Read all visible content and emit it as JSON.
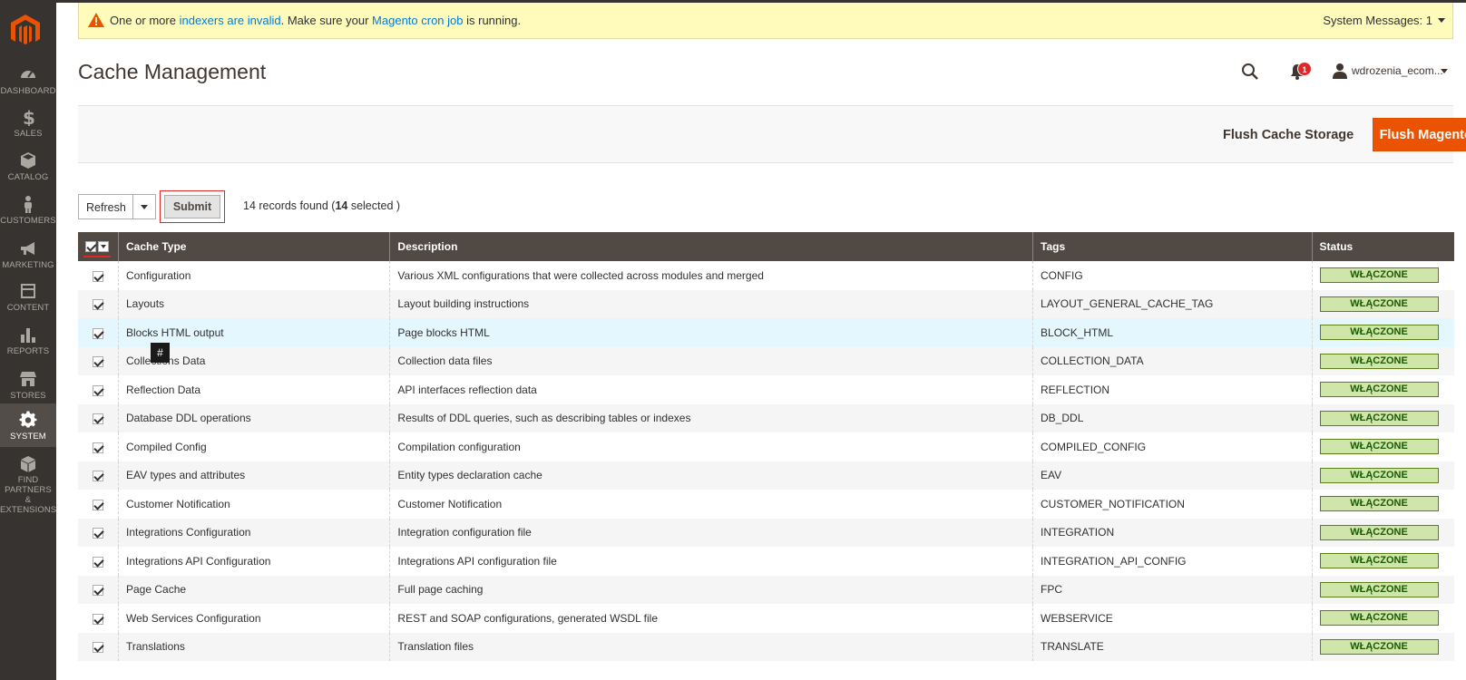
{
  "sidebar": {
    "items": [
      {
        "label": "DASHBOARD",
        "icon": "dashboard-icon"
      },
      {
        "label": "SALES",
        "icon": "dollar-icon"
      },
      {
        "label": "CATALOG",
        "icon": "box-icon"
      },
      {
        "label": "CUSTOMERS",
        "icon": "person-icon"
      },
      {
        "label": "MARKETING",
        "icon": "megaphone-icon"
      },
      {
        "label": "CONTENT",
        "icon": "layout-icon"
      },
      {
        "label": "REPORTS",
        "icon": "bar-chart-icon"
      },
      {
        "label": "STORES",
        "icon": "store-icon"
      },
      {
        "label": "SYSTEM",
        "icon": "gear-icon"
      },
      {
        "label": "FIND PARTNERS",
        "label2": "& EXTENSIONS",
        "icon": "cube-icon"
      }
    ],
    "active": "SYSTEM"
  },
  "system_message": {
    "part1": "One or more ",
    "link1": "indexers are invalid",
    "part2": ". Make sure your ",
    "link2": "Magento cron job",
    "part3": " is running.",
    "count_label": "System Messages: 1"
  },
  "header": {
    "title": "Cache Management",
    "notifications_count": "1",
    "user_name": "wdrozenia_ecom..."
  },
  "actions": {
    "flush_storage": "Flush Cache Storage",
    "flush_magento": "Flush Magento Cache"
  },
  "massaction": {
    "selected_option": "Refresh",
    "submit_label": "Submit",
    "records_prefix": "14 records found (",
    "records_selected": "14",
    "records_suffix": " selected )"
  },
  "grid": {
    "columns": [
      "Cache Type",
      "Description",
      "Tags",
      "Status"
    ],
    "rows": [
      {
        "type": "Configuration",
        "description": "Various XML configurations that were collected across modules and merged",
        "tags": "CONFIG",
        "status": "WŁĄCZONE"
      },
      {
        "type": "Layouts",
        "description": "Layout building instructions",
        "tags": "LAYOUT_GENERAL_CACHE_TAG",
        "status": "WŁĄCZONE"
      },
      {
        "type": "Blocks HTML output",
        "description": "Page blocks HTML",
        "tags": "BLOCK_HTML",
        "status": "WŁĄCZONE"
      },
      {
        "type": "Collections Data",
        "description": "Collection data files",
        "tags": "COLLECTION_DATA",
        "status": "WŁĄCZONE"
      },
      {
        "type": "Reflection Data",
        "description": "API interfaces reflection data",
        "tags": "REFLECTION",
        "status": "WŁĄCZONE"
      },
      {
        "type": "Database DDL operations",
        "description": "Results of DDL queries, such as describing tables or indexes",
        "tags": "DB_DDL",
        "status": "WŁĄCZONE"
      },
      {
        "type": "Compiled Config",
        "description": "Compilation configuration",
        "tags": "COMPILED_CONFIG",
        "status": "WŁĄCZONE"
      },
      {
        "type": "EAV types and attributes",
        "description": "Entity types declaration cache",
        "tags": "EAV",
        "status": "WŁĄCZONE"
      },
      {
        "type": "Customer Notification",
        "description": "Customer Notification",
        "tags": "CUSTOMER_NOTIFICATION",
        "status": "WŁĄCZONE"
      },
      {
        "type": "Integrations Configuration",
        "description": "Integration configuration file",
        "tags": "INTEGRATION",
        "status": "WŁĄCZONE"
      },
      {
        "type": "Integrations API Configuration",
        "description": "Integrations API configuration file",
        "tags": "INTEGRATION_API_CONFIG",
        "status": "WŁĄCZONE"
      },
      {
        "type": "Page Cache",
        "description": "Full page caching",
        "tags": "FPC",
        "status": "WŁĄCZONE"
      },
      {
        "type": "Web Services Configuration",
        "description": "REST and SOAP configurations, generated WSDL file",
        "tags": "WEBSERVICE",
        "status": "WŁĄCZONE"
      },
      {
        "type": "Translations",
        "description": "Translation files",
        "tags": "TRANSLATE",
        "status": "WŁĄCZONE"
      }
    ]
  },
  "tooltip": "#",
  "colors": {
    "sidebar_bg": "#373330",
    "accent": "#eb5202",
    "status_bg": "#d0e5a9",
    "grid_header": "#514943"
  }
}
